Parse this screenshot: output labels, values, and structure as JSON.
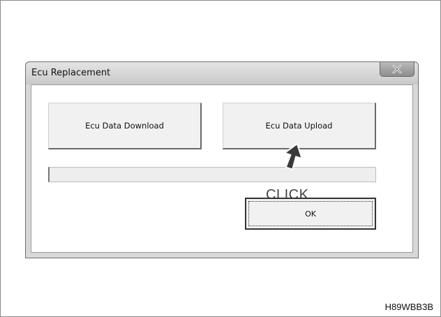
{
  "window": {
    "title": "Ecu Replacement"
  },
  "buttons": {
    "download_label": "Ecu Data Download",
    "upload_label": "Ecu Data Upload",
    "ok_label": "OK"
  },
  "progress": {
    "value_percent": 0
  },
  "annotation": {
    "click_label": "CLICK"
  },
  "figure_code": "H89WBB3B",
  "icons": {
    "close": "close-icon",
    "pointer": "arrow-cursor-icon"
  },
  "colors": {
    "window_bg": "#d8d8d8",
    "button_bg": "#f1f1f1",
    "client_bg": "#ffffff"
  }
}
